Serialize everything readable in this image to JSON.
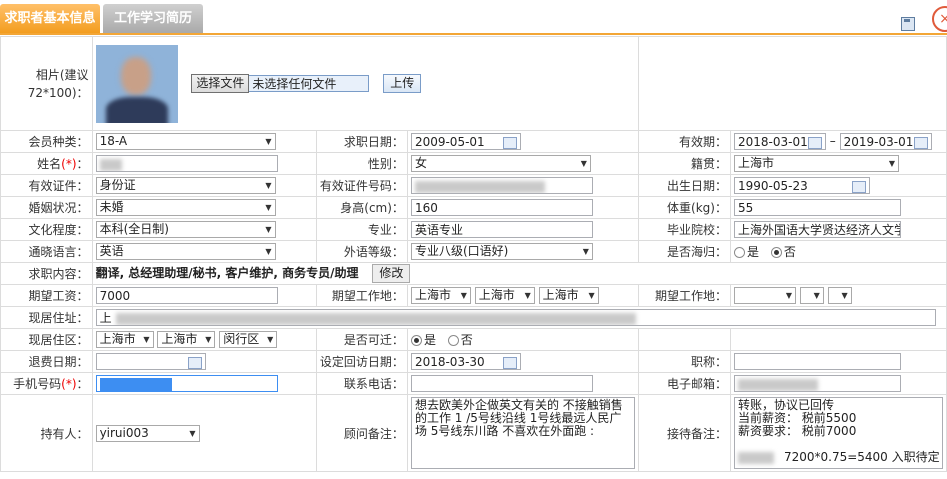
{
  "tabs": [
    "求职者基本信息",
    "工作学习简历"
  ],
  "icons": {
    "save": "save-icon",
    "close": "close-icon"
  },
  "photo": {
    "label": "相片(建议72*100)：",
    "choose_button": "选择文件",
    "no_file": "未选择任何文件",
    "upload_button": "上传"
  },
  "row1": {
    "member_type_label": "会员种类：",
    "member_type": "18-A",
    "apply_date_label": "求职日期：",
    "apply_date": "2009-05-01",
    "valid_label": "有效期：",
    "valid_from": "2018-03-01",
    "valid_sep": "–",
    "valid_to": "2019-03-01"
  },
  "row2": {
    "name_label": "姓名",
    "req_mark": "(*)",
    "colon": "：",
    "gender_label": "性别：",
    "gender": "女",
    "native_label": "籍贯：",
    "native": "上海市"
  },
  "row3": {
    "id_type_label": "有效证件：",
    "id_type": "身份证",
    "id_no_label": "有效证件号码：",
    "birth_label": "出生日期：",
    "birth": "1990-05-23"
  },
  "row4": {
    "marital_label": "婚姻状况：",
    "marital": "未婚",
    "height_label": "身高(cm)：",
    "height": "160",
    "weight_label": "体重(kg)：",
    "weight": "55"
  },
  "row5": {
    "edu_label": "文化程度：",
    "edu": "本科(全日制)",
    "major_label": "专业：",
    "major": "英语专业",
    "school_label": "毕业院校：",
    "school": "上海外国语大学贤达经济人文学"
  },
  "row6": {
    "lang_label": "通晓语言：",
    "lang": "英语",
    "lang_level_label": "外语等级：",
    "lang_level": "专业八级(口语好)",
    "abroad_label": "是否海归：",
    "opt_yes": "是",
    "opt_no": "否"
  },
  "row7": {
    "content_label": "求职内容：",
    "content": "翻译, 总经理助理/秘书, 客户维护, 商务专员/助理",
    "edit_button": "修改"
  },
  "row8": {
    "salary_label": "期望工资：",
    "salary": "7000",
    "place_label": "期望工作地：",
    "place1": "上海市",
    "place2": "上海市",
    "place3": "上海市",
    "place_label2": "期望工作地："
  },
  "row9": {
    "address_label": "现居住址：",
    "address_prefix": "上"
  },
  "row10": {
    "district_label": "现居住区：",
    "d1": "上海市",
    "d2": "上海市",
    "d3": "闵行区",
    "relocate_label": "是否可迁：",
    "opt_yes": "是",
    "opt_no": "否"
  },
  "row11": {
    "refund_label": "退费日期：",
    "visit_label": "设定回访日期：",
    "visit_date": "2018-03-30",
    "title_label": "职称："
  },
  "row12": {
    "mobile_label": "手机号码",
    "req_mark": "(*)",
    "colon": "：",
    "tel_label": "联系电话：",
    "email_label": "电子邮箱："
  },
  "row13": {
    "holder_label": "持有人：",
    "holder": "yirui003",
    "consult_label": "顾问备注：",
    "consult_note": "想去欧美外企做英文有关的 不接触销售的工作 1 /5号线沿线 1号线最远人民广场 5号线东川路 不喜欢在外面跑 :",
    "reception_label": "接待备注：",
    "reception_l1": "转账，协议已回传",
    "reception_l2": "当前薪资： 税前5500",
    "reception_l3": "薪资要求： 税前7000",
    "reception_l4": "7200*0.75=5400 入职待定"
  }
}
